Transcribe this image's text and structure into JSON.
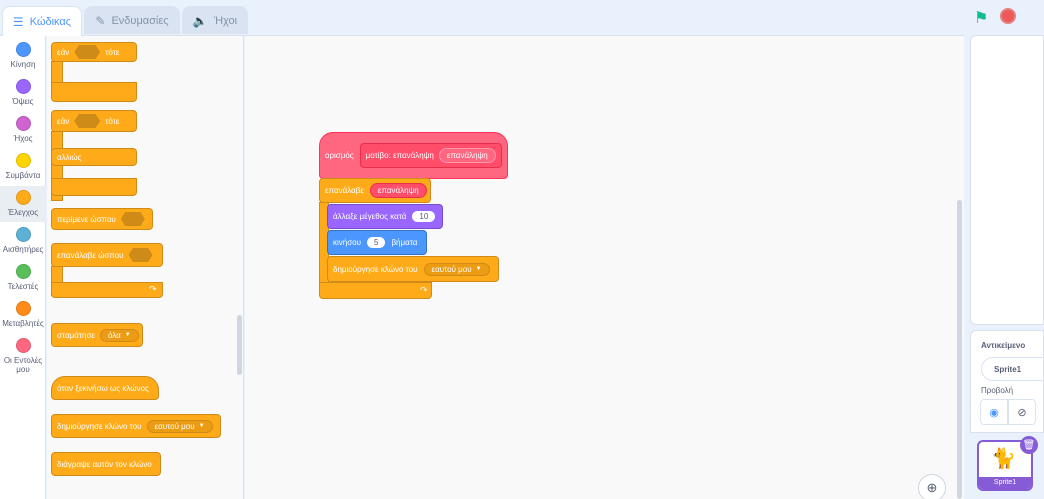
{
  "tabs": [
    {
      "label": "Κώδικας",
      "icon": "code-icon"
    },
    {
      "label": "Ενδυμασίες",
      "icon": "costume-icon"
    },
    {
      "label": "Ήχοι",
      "icon": "speaker-icon"
    }
  ],
  "categories": [
    {
      "label": "Κίνηση",
      "color": "#4c97ff"
    },
    {
      "label": "Όψεις",
      "color": "#9966ff"
    },
    {
      "label": "Ήχος",
      "color": "#cf63cf"
    },
    {
      "label": "Συμβάντα",
      "color": "#ffd500"
    },
    {
      "label": "Έλεγχος",
      "color": "#ffab19"
    },
    {
      "label": "Αισθητήρες",
      "color": "#5cb1d6"
    },
    {
      "label": "Τελεστές",
      "color": "#59c059"
    },
    {
      "label": "Μεταβλητές",
      "color": "#ff8c1a"
    },
    {
      "label": "Οι Εντολές μου",
      "color": "#ff6680"
    }
  ],
  "palette": {
    "if_then": {
      "if": "εάν",
      "then": "τότε"
    },
    "if_else": {
      "if": "εάν",
      "then": "τότε",
      "else": "αλλιώς"
    },
    "wait_until": "περίμενε ώσπου",
    "repeat_until": "επανάλαβε ώσπου",
    "stop": {
      "label": "σταμάτησε",
      "value": "όλα"
    },
    "when_clone": "όταν ξεκινήσω ως κλώνος",
    "create_clone": {
      "label": "δημιούργησε κλώνο του",
      "value": "εαυτού μου"
    },
    "delete_clone": "διάγραψε αυτόν τον κλώνο"
  },
  "script": {
    "define": {
      "label": "ορισμός",
      "proc": "μοτίβο: επανάληψη",
      "param": "επανάληψη"
    },
    "repeat": {
      "label": "επανάλαβε",
      "param": "επανάληψη"
    },
    "change_size": {
      "label": "άλλαξε μέγεθος κατά",
      "value": "10"
    },
    "move": {
      "label": "κινήσου",
      "value": "5",
      "unit": "βήματα"
    },
    "create_clone": {
      "label": "δημιούργησε κλώνο του",
      "value": "εαυτού μου"
    }
  },
  "sprite_info": {
    "sprite_label": "Αντικείμενο",
    "sprite_name": "Sprite1",
    "show_label": "Προβολή"
  },
  "sprite_list": [
    {
      "name": "Sprite1"
    }
  ]
}
